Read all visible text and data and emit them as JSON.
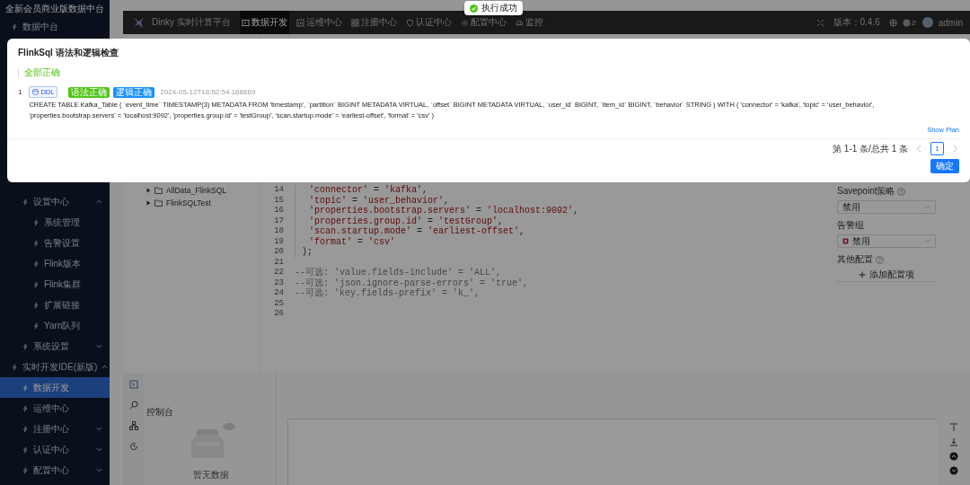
{
  "sidebar": {
    "title": "全新会员商业版数据中台",
    "items": [
      {
        "label": "数据中台",
        "selected": false,
        "children": [
          {
            "label": "设置中心",
            "selected": false,
            "expanded": true,
            "children": [
              {
                "label": "系统管理",
                "selected": false
              },
              {
                "label": "告警设置",
                "selected": false
              },
              {
                "label": "Flink版本",
                "selected": false
              },
              {
                "label": "Flink集群",
                "selected": false
              },
              {
                "label": "扩展链接",
                "selected": false
              },
              {
                "label": "Yarn队列",
                "selected": false
              }
            ]
          },
          {
            "label": "系统设置",
            "selected": false,
            "expanded": false
          }
        ]
      },
      {
        "label": "实时开发IDE(新版)",
        "selected": false,
        "expanded": true,
        "children": [
          {
            "label": "数据开发",
            "selected": true
          },
          {
            "label": "运维中心",
            "selected": false
          },
          {
            "label": "注册中心",
            "selected": false,
            "expanded": false
          },
          {
            "label": "认证中心",
            "selected": false,
            "expanded": false
          },
          {
            "label": "配置中心",
            "selected": false,
            "expanded": false
          }
        ]
      }
    ]
  },
  "header": {
    "app_name": "Dinky 实时计算平台",
    "nav": [
      {
        "label": "数据开发",
        "selected": true,
        "kind": "develop"
      },
      {
        "label": "运维中心",
        "selected": false,
        "kind": "ops"
      },
      {
        "label": "注册中心",
        "selected": false,
        "kind": "registry"
      },
      {
        "label": "认证中心",
        "selected": false,
        "kind": "auth"
      },
      {
        "label": "配置中心",
        "selected": false,
        "kind": "config"
      },
      {
        "label": "监控",
        "selected": false,
        "kind": "monitor"
      }
    ],
    "version": "版本：0.4.6",
    "user": "admin"
  },
  "file_tree": {
    "items": [
      {
        "label": "AllData_FlinkSQL",
        "expanded": false
      },
      {
        "label": "FlinkSQLTest",
        "expanded": false
      }
    ]
  },
  "editor": {
    "lines": [
      {
        "number": "14",
        "kind": "property",
        "tokens": [
          {
            "kind": "string",
            "text": "'connector'"
          },
          {
            "kind": "plain",
            "text": " = "
          },
          {
            "kind": "string",
            "text": "'kafka'"
          },
          {
            "kind": "plain",
            "text": ","
          }
        ]
      },
      {
        "number": "15",
        "kind": "property",
        "tokens": [
          {
            "kind": "string",
            "text": "'topic'"
          },
          {
            "kind": "plain",
            "text": " = "
          },
          {
            "kind": "string",
            "text": "'user_behavior'"
          },
          {
            "kind": "plain",
            "text": ","
          }
        ]
      },
      {
        "number": "16",
        "kind": "property",
        "tokens": [
          {
            "kind": "string",
            "text": "'properties.bootstrap.servers'"
          },
          {
            "kind": "plain",
            "text": " = "
          },
          {
            "kind": "string",
            "text": "'localhost:9092'"
          },
          {
            "kind": "plain",
            "text": ","
          }
        ]
      },
      {
        "number": "17",
        "kind": "property",
        "tokens": [
          {
            "kind": "string",
            "text": "'properties.group.id'"
          },
          {
            "kind": "plain",
            "text": " = "
          },
          {
            "kind": "string",
            "text": "'testGroup'"
          },
          {
            "kind": "plain",
            "text": ","
          }
        ]
      },
      {
        "number": "18",
        "kind": "property",
        "tokens": [
          {
            "kind": "string",
            "text": "'scan.startup.mode'"
          },
          {
            "kind": "plain",
            "text": " = "
          },
          {
            "kind": "string",
            "text": "'earliest-offset'"
          },
          {
            "kind": "plain",
            "text": ","
          }
        ]
      },
      {
        "number": "19",
        "kind": "property",
        "tokens": [
          {
            "kind": "string",
            "text": "'format'"
          },
          {
            "kind": "plain",
            "text": " = "
          },
          {
            "kind": "string",
            "text": "'csv'"
          }
        ]
      },
      {
        "number": "20",
        "kind": "close",
        "tokens": [
          {
            "kind": "plain",
            "text": ");"
          }
        ]
      },
      {
        "number": "21",
        "kind": "blank"
      },
      {
        "number": "22",
        "kind": "comment",
        "tokens": [
          {
            "kind": "comment",
            "text": "--可选: 'value.fields-include' = 'ALL',"
          }
        ]
      },
      {
        "number": "23",
        "kind": "comment",
        "tokens": [
          {
            "kind": "comment",
            "text": "--可选: 'json.ignore-parse-errors' = 'true',"
          }
        ]
      },
      {
        "number": "24",
        "kind": "comment",
        "tokens": [
          {
            "kind": "comment",
            "text": "--可选: 'key.fields-prefix' = 'k_',"
          }
        ]
      },
      {
        "number": "25",
        "kind": "blank"
      },
      {
        "number": "26",
        "kind": "blank"
      }
    ]
  },
  "job_config": {
    "fields": [
      {
        "label": "Savepoint策略",
        "help": true,
        "kind": "select",
        "value": "禁用"
      },
      {
        "label": "告警组",
        "help": false,
        "kind": "tagged",
        "value": "禁用"
      },
      {
        "label": "其他配置",
        "help": true,
        "kind": "adder",
        "value": "添加配置项"
      }
    ]
  },
  "console": {
    "title": "控制台",
    "empty_text": "暂无数据"
  },
  "modal": {
    "title": "FlinkSql 语法和逻辑检查",
    "summary": "全部正确",
    "results": [
      {
        "index": "1",
        "type": "DDL",
        "tags": [
          {
            "label": "语法正确",
            "color": "#52c41a"
          },
          {
            "label": "逻辑正确",
            "color": "#1890ff"
          }
        ],
        "time": "2024-05-12T18:52:54.168669",
        "sql": "CREATE TABLE Kafka_Table ( `event_time` TIMESTAMP(3) METADATA FROM 'timestamp', `partition` BIGINT METADATA VIRTUAL, `offset` BIGINT METADATA VIRTUAL, `user_id` BIGINT, `item_id` BIGINT, `behavior` STRING ) WITH ( 'connector' = 'kafka', 'topic' = 'user_behavior', 'properties.bootstrap.servers' = 'localhost:9092', 'properties.group.id' = 'testGroup', 'scan.startup.mode' = 'earliest-offset', 'format' = 'csv' )",
        "link": "Show Plan"
      }
    ],
    "pagination": {
      "summary": "第 1-1 条/总共 1 条",
      "pages": [
        {
          "label": "1",
          "selected": true
        }
      ]
    },
    "ok_button": "确定"
  },
  "toast": {
    "text": "执行成功"
  }
}
